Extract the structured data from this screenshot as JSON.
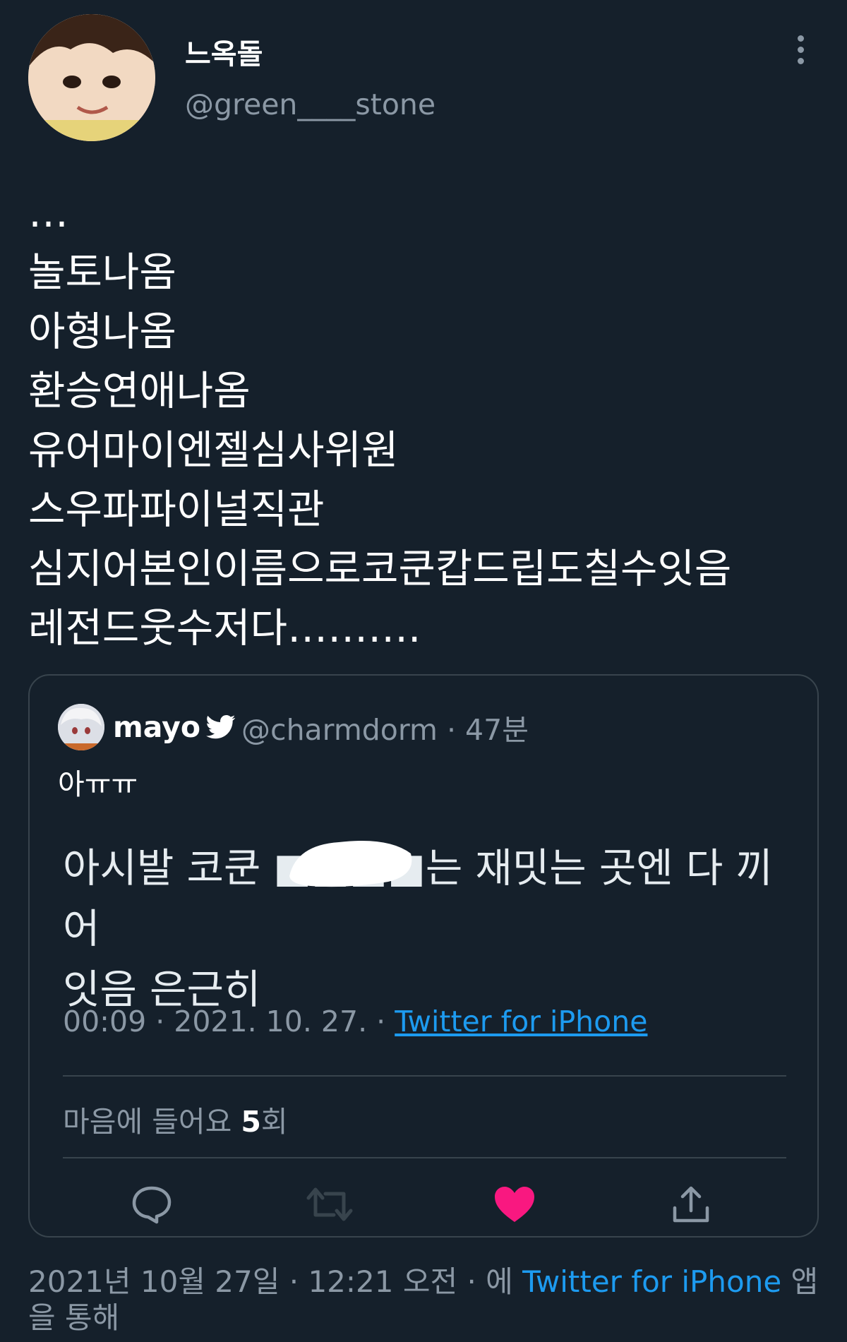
{
  "tweet": {
    "display_name": "느옥돌",
    "handle": "@green____stone",
    "body": "…\n놀토나옴\n아형나옴\n환승연애나옴\n유어마이엔젤심사위원\n스우파파이널직관\n심지어본인이름으로코쿤캅드립도칠수잇음\n레전드웃수저다………."
  },
  "quote": {
    "display_name": "mayo",
    "handle_time": "@charmdorm · 47분",
    "text": "아ㅠㅠ",
    "inner": {
      "text": "아시발 코쿤 ■■■■는 재밋는 곳엔 다 끼어\n잇음 은근히",
      "meta_prefix": "00:09 · 2021. 10. 27. · ",
      "meta_link": "Twitter for iPhone",
      "likes_prefix": "마음에 들어요 ",
      "likes_count": "5",
      "likes_suffix": "회"
    }
  },
  "footer": {
    "prefix": "2021년 10월 27일 · 12:21 오전 · 에 ",
    "link": "Twitter for iPhone",
    "suffix": " 앱을 통해"
  },
  "colors": {
    "background": "#15202b",
    "secondary_text": "#8b98a5",
    "link": "#1d9bf0",
    "like": "#f91880",
    "border": "#38444d"
  },
  "icons": [
    "more-vertical-icon",
    "verified-bird-icon",
    "reply-icon",
    "retweet-icon",
    "like-icon",
    "share-icon"
  ]
}
